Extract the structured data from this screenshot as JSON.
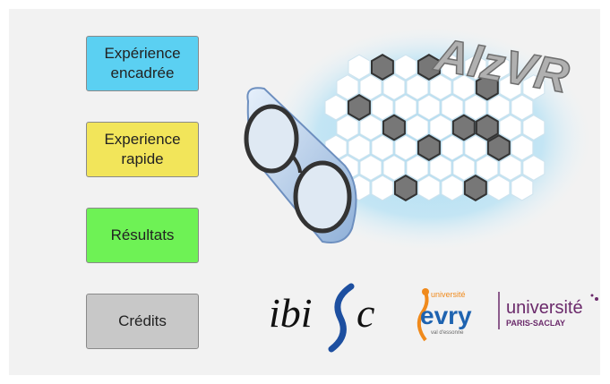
{
  "menu": {
    "experience_encadree": "Expérience\nencadrée",
    "experience_rapide": "Experience\nrapide",
    "resultats": "Résultats",
    "credits": "Crédits"
  },
  "logo": {
    "title": "AIzVR"
  },
  "partners": {
    "ibisc": "ibi",
    "ibisc_c": "c",
    "evry_top": "université",
    "evry_main": "evry",
    "evry_sub": "val d'essonne",
    "saclay_top": "université",
    "saclay_bottom": "PARIS-SACLAY"
  },
  "colors": {
    "btn_encadree": "#5bd0f2",
    "btn_rapide": "#f2e55a",
    "btn_resultats": "#6ef255",
    "btn_credits": "#c8c8c8"
  }
}
